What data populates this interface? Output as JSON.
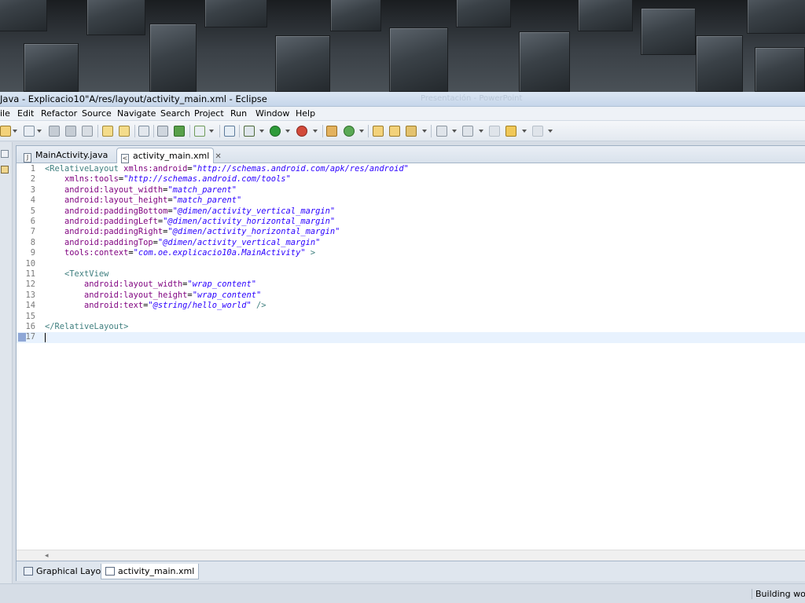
{
  "window": {
    "title": "Java - Explicacio10\"A/res/layout/activity_main.xml - Eclipse",
    "background_ghost_title": "Presentación - PowerPoint"
  },
  "menu": [
    "ile",
    "Edit",
    "Refactor",
    "Source",
    "Navigate",
    "Search",
    "Project",
    "Run",
    "Window",
    "Help"
  ],
  "editor": {
    "tabs": [
      {
        "label": "MainActivity.java",
        "icon": "java-file-icon",
        "active": false
      },
      {
        "label": "activity_main.xml",
        "icon": "xml-file-icon",
        "active": true
      }
    ],
    "lines": [
      {
        "n": "1",
        "tokens": [
          [
            "t",
            "<RelativeLayout "
          ],
          [
            "a",
            "xmlns:android"
          ],
          [
            "p",
            "="
          ],
          [
            "v",
            "\"http://schemas.android.com/apk/res/android\""
          ]
        ]
      },
      {
        "n": "2",
        "tokens": [
          [
            "p",
            "    "
          ],
          [
            "a",
            "xmlns:tools"
          ],
          [
            "p",
            "="
          ],
          [
            "v",
            "\"http://schemas.android.com/tools\""
          ]
        ]
      },
      {
        "n": "3",
        "tokens": [
          [
            "p",
            "    "
          ],
          [
            "a",
            "android:layout_width"
          ],
          [
            "p",
            "="
          ],
          [
            "v",
            "\"match_parent\""
          ]
        ]
      },
      {
        "n": "4",
        "tokens": [
          [
            "p",
            "    "
          ],
          [
            "a",
            "android:layout_height"
          ],
          [
            "p",
            "="
          ],
          [
            "v",
            "\"match_parent\""
          ]
        ]
      },
      {
        "n": "5",
        "tokens": [
          [
            "p",
            "    "
          ],
          [
            "a",
            "android:paddingBottom"
          ],
          [
            "p",
            "="
          ],
          [
            "v",
            "\"@dimen/activity_vertical_margin\""
          ]
        ]
      },
      {
        "n": "6",
        "tokens": [
          [
            "p",
            "    "
          ],
          [
            "a",
            "android:paddingLeft"
          ],
          [
            "p",
            "="
          ],
          [
            "v",
            "\"@dimen/activity_horizontal_margin\""
          ]
        ]
      },
      {
        "n": "7",
        "tokens": [
          [
            "p",
            "    "
          ],
          [
            "a",
            "android:paddingRight"
          ],
          [
            "p",
            "="
          ],
          [
            "v",
            "\"@dimen/activity_horizontal_margin\""
          ]
        ]
      },
      {
        "n": "8",
        "tokens": [
          [
            "p",
            "    "
          ],
          [
            "a",
            "android:paddingTop"
          ],
          [
            "p",
            "="
          ],
          [
            "v",
            "\"@dimen/activity_vertical_margin\""
          ]
        ]
      },
      {
        "n": "9",
        "tokens": [
          [
            "p",
            "    "
          ],
          [
            "a",
            "tools:context"
          ],
          [
            "p",
            "="
          ],
          [
            "v",
            "\"com.oe.explicacio10a.MainActivity\""
          ],
          [
            "t",
            " >"
          ]
        ]
      },
      {
        "n": "10",
        "tokens": []
      },
      {
        "n": "11",
        "tokens": [
          [
            "p",
            "    "
          ],
          [
            "t",
            "<TextView"
          ]
        ]
      },
      {
        "n": "12",
        "tokens": [
          [
            "p",
            "        "
          ],
          [
            "a",
            "android:layout_width"
          ],
          [
            "p",
            "="
          ],
          [
            "v",
            "\"wrap_content\""
          ]
        ]
      },
      {
        "n": "13",
        "tokens": [
          [
            "p",
            "        "
          ],
          [
            "a",
            "android:layout_height"
          ],
          [
            "p",
            "="
          ],
          [
            "v",
            "\"wrap_content\""
          ]
        ]
      },
      {
        "n": "14",
        "tokens": [
          [
            "p",
            "        "
          ],
          [
            "a",
            "android:text"
          ],
          [
            "p",
            "="
          ],
          [
            "v",
            "\"@string/hello_world\""
          ],
          [
            "t",
            " />"
          ]
        ]
      },
      {
        "n": "15",
        "tokens": []
      },
      {
        "n": "16",
        "tokens": [
          [
            "t",
            "</RelativeLayout>"
          ]
        ]
      },
      {
        "n": "17",
        "tokens": [],
        "current": true
      }
    ],
    "bottom_tabs": [
      {
        "label": "Graphical Layout",
        "icon": "graphical-layout-icon",
        "active": false
      },
      {
        "label": "activity_main.xml",
        "icon": "xml-source-icon",
        "active": true
      }
    ]
  },
  "status": {
    "text": "Building work"
  },
  "colors": {
    "tag": "#3f7f7f",
    "attribute": "#7f007f",
    "value": "#2a00ff",
    "current_line": "#e8f2fe"
  }
}
